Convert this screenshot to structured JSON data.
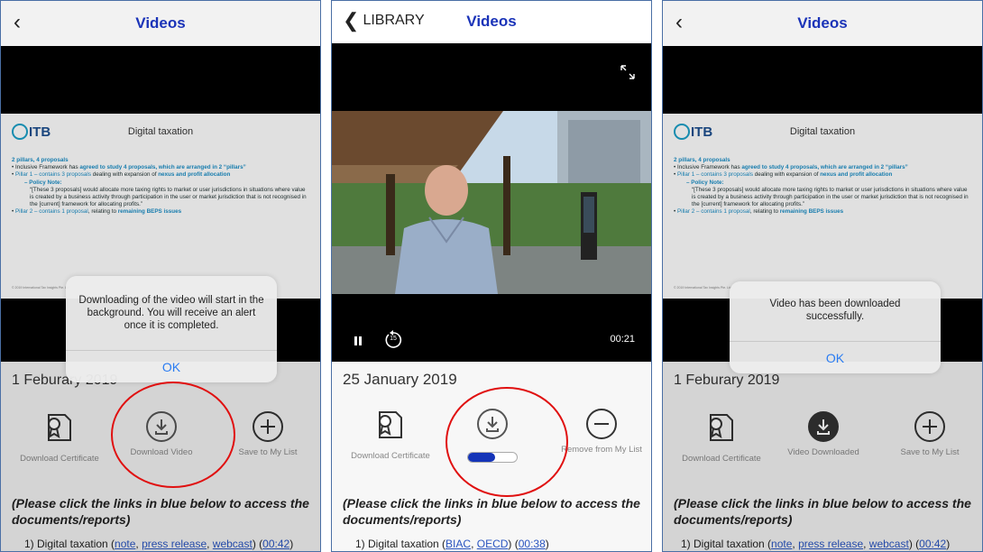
{
  "nav": {
    "title": "Videos",
    "back_library": "LIBRARY"
  },
  "slide": {
    "logo": "ITB",
    "title": "Digital taxation",
    "line1": "2 pillars, 4 proposals",
    "line2_pre": "Inclusive Framework has ",
    "line2_hl": "agreed to study 4 proposals, which are arranged in 2 “pillars”",
    "line3_pre": "Pillar 1 – contains ",
    "line3_num": "3 proposals",
    "line3_mid": " dealing with expansion of ",
    "line3_hl": "nexus and profit allocation",
    "line4": "– Policy Note:",
    "quote": "“[These 3 proposals] would allocate more taxing rights to market or user jurisdictions in situations where value is created by a business activity through participation in the user or market jurisdiction that is not recognised in the [current] framework for allocating profits.”",
    "line5_pre": "Pillar 2 – contains ",
    "line5_num": "1 proposal",
    "line5_mid": ", relating to ",
    "line5_hl": "remaining BEPS issues",
    "footer": "© 2019 International Tax Insights Pte. Ltd."
  },
  "screen1": {
    "date": "1 Feburary 2019",
    "dialog_msg": "Downloading of the video will start in the background. You will receive an alert once it is completed.",
    "dialog_ok": "OK",
    "cert_label": "Download Certificate",
    "download_label": "Download Video",
    "save_label": "Save to My List"
  },
  "screen2": {
    "date": "25 January 2019",
    "time": "00:21",
    "skip": "15",
    "download_progress": 0.55,
    "cert_label": "Download Certificate",
    "remove_label": "Remove from My List"
  },
  "screen3": {
    "date": "1 Feburary 2019",
    "dialog_msg": "Video has been downloaded successfully.",
    "dialog_ok": "OK",
    "cert_label": "Download Certificate",
    "downloaded_label": "Video Downloaded",
    "save_label": "Save to My List"
  },
  "notice": "(Please click the links in blue below to access the documents/reports)",
  "links1": {
    "prefix": "1) Digital taxation (",
    "note": "note",
    "sep1": ", ",
    "press": "press release",
    "sep2": ", ",
    "webcast": "webcast",
    "mid": ") (",
    "time": "00:42",
    "end": ")"
  },
  "links2": {
    "prefix": "1) Digital taxation (",
    "biac": "BIAC",
    "sep1": ", ",
    "oecd": "OECD",
    "mid": ") (",
    "time": "00:38",
    "end": ")"
  },
  "colors": {
    "title_blue": "#1a33b8",
    "link_blue": "#2a55c0",
    "ios_blue": "#2a7cf2",
    "red_ring": "#e01010",
    "progress": "#1434b8"
  }
}
